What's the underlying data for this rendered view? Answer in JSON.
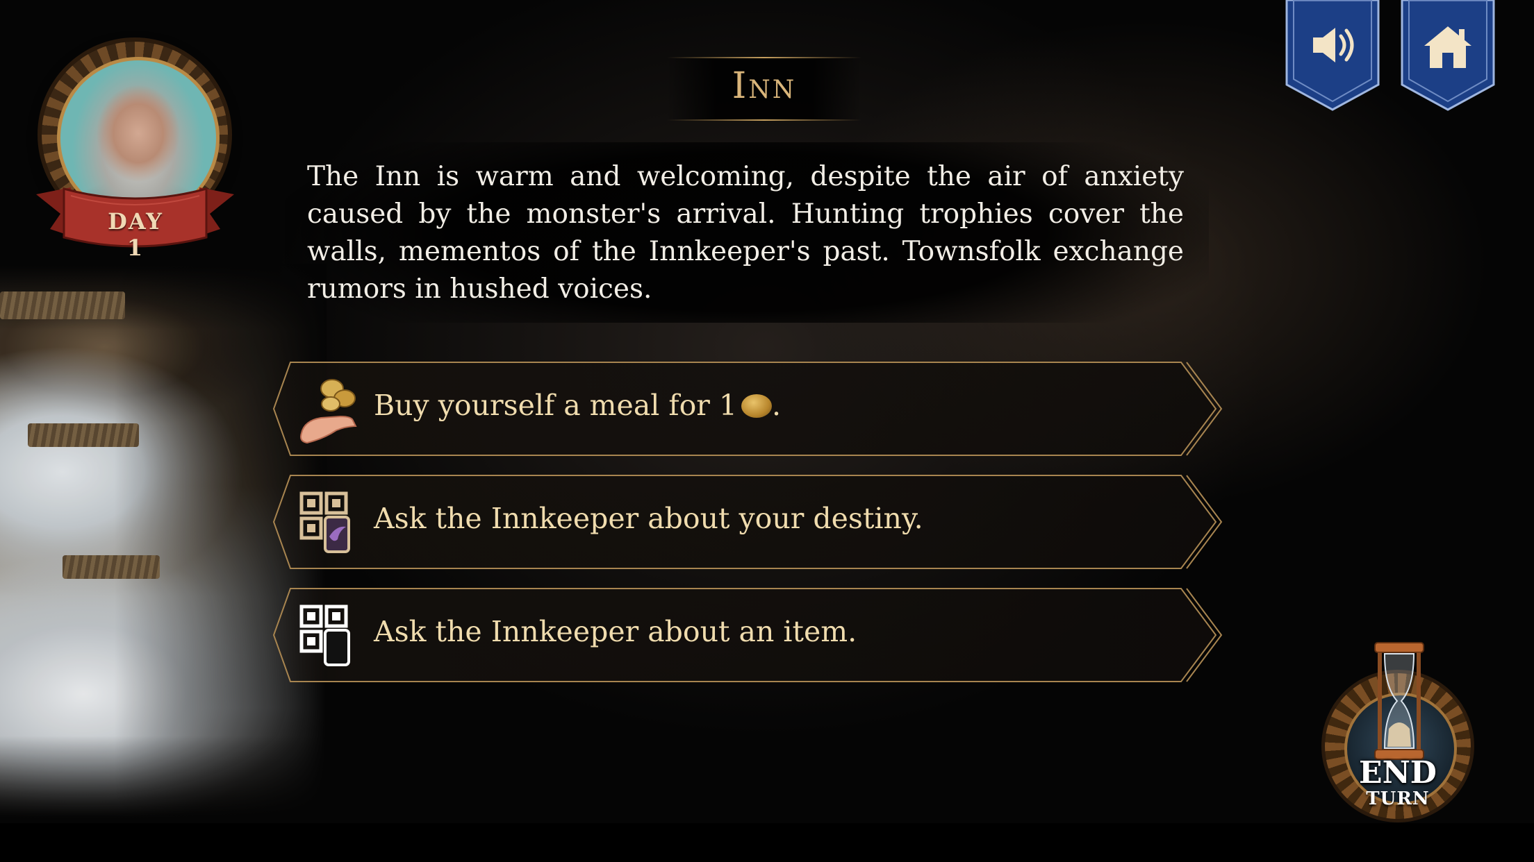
{
  "header": {
    "day_label": "DAY 1",
    "location_title": "Inn"
  },
  "scene": {
    "description": "The Inn is warm and welcoming, despite the air of anxiety caused by the monster's arrival. Hunting trophies cover the walls, mementos of the Innkeeper's past. Townsfolk exchange rumors in hushed voices."
  },
  "choices": [
    {
      "label": "Buy yourself a meal for 1",
      "suffix": ".",
      "icon": "coins-in-hand-icon",
      "inline_icon": "gold-coin-icon"
    },
    {
      "label": "Ask the Innkeeper about your destiny.",
      "icon": "qr-scan-destiny-icon"
    },
    {
      "label": "Ask the Innkeeper about an item.",
      "icon": "qr-scan-phone-icon"
    }
  ],
  "controls": {
    "sound_icon": "speaker-icon",
    "home_icon": "home-icon",
    "end_turn_big": "END",
    "end_turn_small": "TURN"
  },
  "colors": {
    "gold_text": "#f0dcae",
    "title_gold": "#d9b57a",
    "banner_blue": "#1c3f86",
    "ribbon_red": "#a8322a"
  }
}
